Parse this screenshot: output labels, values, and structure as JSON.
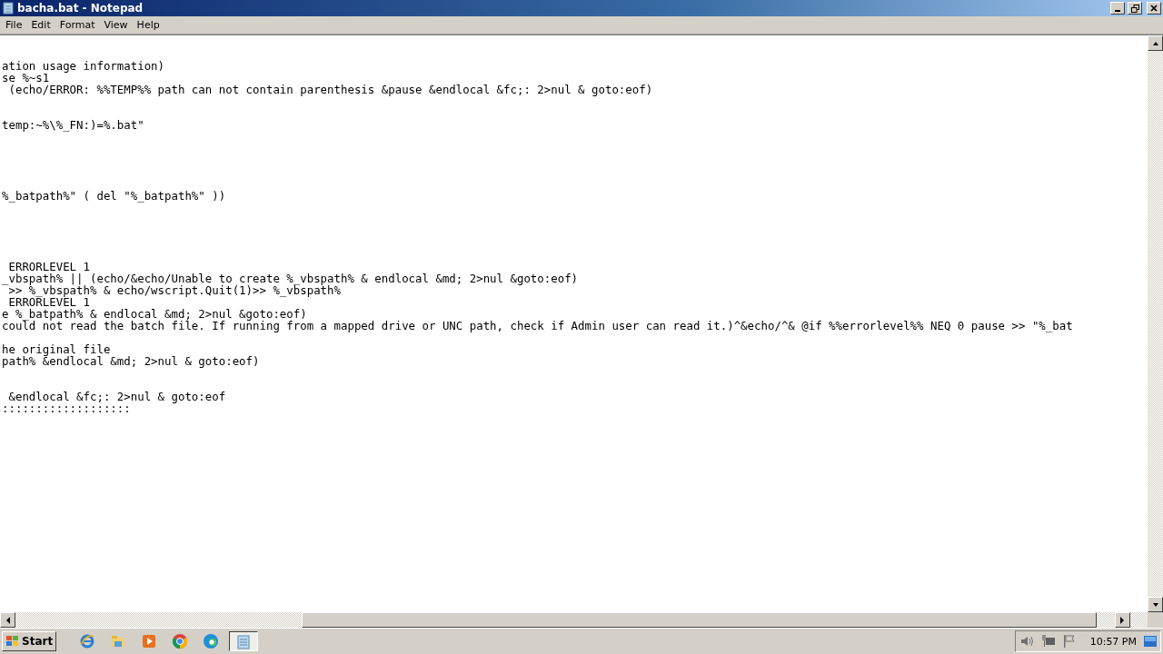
{
  "window": {
    "title": "bacha.bat - Notepad"
  },
  "menu": [
    "File",
    "Edit",
    "Format",
    "View",
    "Help"
  ],
  "lines": [
    {
      "kind": "blank"
    },
    {
      "kind": "blank"
    },
    {
      "kind": "code",
      "text": "ation usage information)"
    },
    {
      "kind": "code",
      "text": "se %~s1"
    },
    {
      "kind": "code",
      "text": " (echo/ERROR: %%TEMP%% path can not contain parenthesis &pause &endlocal &fc;: 2>nul & goto:eof)"
    },
    {
      "kind": "blank"
    },
    {
      "kind": "blank"
    },
    {
      "kind": "code",
      "text": "temp:~%\\%_FN:)=%.bat\""
    },
    {
      "kind": "blank"
    },
    {
      "kind": "blank"
    },
    {
      "kind": "blank"
    },
    {
      "kind": "blank"
    },
    {
      "kind": "blank"
    },
    {
      "kind": "code",
      "text": "%_batpath%\" ( del \"%_batpath%\" ))"
    },
    {
      "kind": "blank"
    },
    {
      "kind": "blank"
    },
    {
      "kind": "blank"
    },
    {
      "kind": "blank"
    },
    {
      "kind": "blank"
    },
    {
      "kind": "code",
      "text": " ERRORLEVEL 1"
    },
    {
      "kind": "code",
      "text": "_vbspath% || (echo/&echo/Unable to create %_vbspath% & endlocal &md; 2>nul &goto:eof)"
    },
    {
      "kind": "code",
      "text": " >> %_vbspath% & echo/wscript.Quit(1)>> %_vbspath%"
    },
    {
      "kind": "code",
      "text": " ERRORLEVEL 1"
    },
    {
      "kind": "code",
      "text": "e %_batpath% & endlocal &md; 2>nul &goto:eof)"
    },
    {
      "kind": "code",
      "text": "could not read the batch file. If running from a mapped drive or UNC path, check if Admin user can read it.)^&echo/^& @if %%errorlevel%% NEQ 0 pause >> \"%_bat"
    },
    {
      "kind": "blank"
    },
    {
      "kind": "code",
      "text": "he original file"
    },
    {
      "kind": "code",
      "text": "path% &endlocal &md; 2>nul & goto:eof)"
    },
    {
      "kind": "blank"
    },
    {
      "kind": "blank"
    },
    {
      "kind": "code",
      "text": " &endlocal &fc;: 2>nul & goto:eof"
    },
    {
      "kind": "code",
      "text": ":::::::::::::::::::"
    }
  ],
  "taskbar": {
    "start": "Start",
    "apps": [
      {
        "kind": "ie",
        "selected": false
      },
      {
        "kind": "explorer",
        "selected": false
      },
      {
        "kind": "media",
        "selected": false
      },
      {
        "kind": "chrome",
        "selected": false
      },
      {
        "kind": "edge",
        "selected": false
      },
      {
        "kind": "notepad",
        "selected": true
      }
    ],
    "clock": "10:57 PM"
  }
}
